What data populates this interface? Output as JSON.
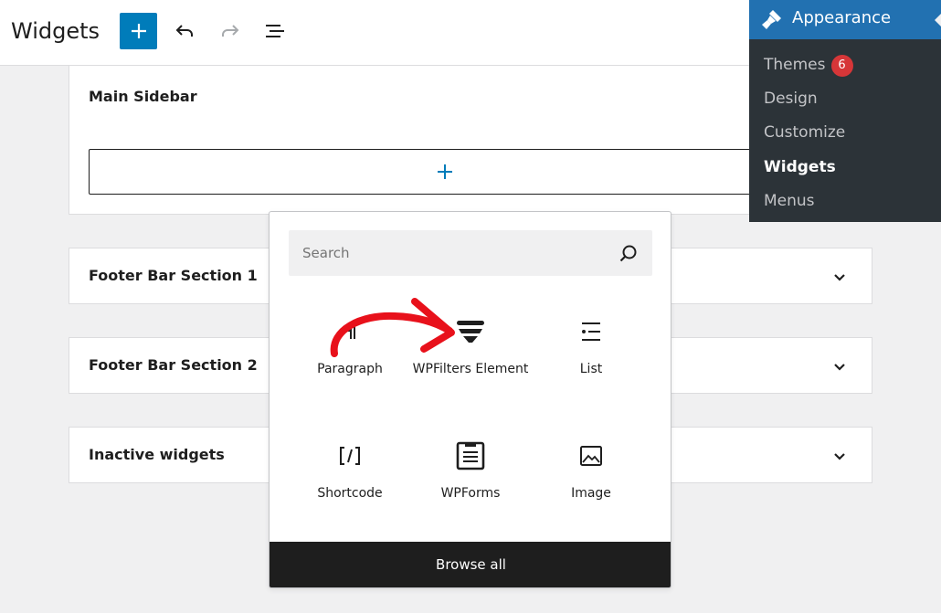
{
  "header": {
    "title": "Widgets",
    "add_icon": "plus-icon",
    "undo_icon": "undo-icon",
    "redo_icon": "redo-icon",
    "list_view_icon": "list-view-icon"
  },
  "areas": {
    "main_sidebar": {
      "title": "Main Sidebar"
    },
    "sections": [
      {
        "title": "Footer Bar Section 1"
      },
      {
        "title": "Footer Bar Section 2"
      },
      {
        "title": "Inactive widgets"
      }
    ]
  },
  "admin_menu": {
    "heading": "Appearance",
    "items": [
      {
        "label": "Themes",
        "badge": "6"
      },
      {
        "label": "Design"
      },
      {
        "label": "Customize"
      },
      {
        "label": "Widgets"
      },
      {
        "label": "Menus"
      }
    ]
  },
  "inserter": {
    "search_placeholder": "Search",
    "blocks": [
      {
        "label": "Paragraph",
        "icon": "paragraph-icon"
      },
      {
        "label": "WPFilters Element",
        "icon": "wpfilters-icon"
      },
      {
        "label": "List",
        "icon": "list-icon"
      },
      {
        "label": "Shortcode",
        "icon": "shortcode-icon"
      },
      {
        "label": "WPForms",
        "icon": "wpforms-icon"
      },
      {
        "label": "Image",
        "icon": "image-icon"
      }
    ],
    "browse_all": "Browse all"
  },
  "colors": {
    "accent": "#007cba",
    "admin_bg": "#2c3338",
    "admin_head": "#2271b1",
    "badge": "#d63638",
    "annotation_arrow": "#e8111b"
  }
}
